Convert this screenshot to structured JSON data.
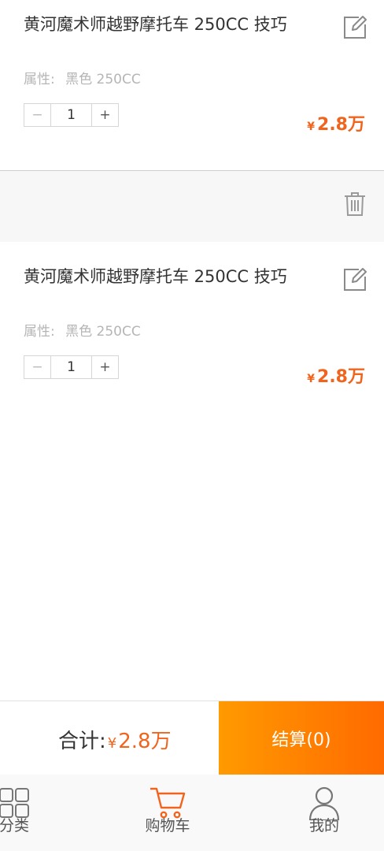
{
  "cart": {
    "items": [
      {
        "title": "黄河魔术师越野摩托车 250CC 技巧",
        "attr_label": "属性:",
        "attr_value": "黑色 250CC",
        "quantity": "1",
        "minus": "−",
        "plus": "+",
        "currency": "¥",
        "price": "2.8万"
      },
      {
        "title": "黄河魔术师越野摩托车 250CC 技巧",
        "attr_label": "属性:",
        "attr_value": "黑色 250CC",
        "quantity": "1",
        "minus": "−",
        "plus": "+",
        "currency": "¥",
        "price": "2.8万"
      }
    ]
  },
  "checkout": {
    "total_label": "合计:",
    "currency": "¥",
    "total_amount": "2.8万",
    "pay_label": "结算(0)"
  },
  "tabbar": {
    "tabs": [
      {
        "label": "分类",
        "icon": "grid-icon"
      },
      {
        "label": "购物车",
        "icon": "cart-icon",
        "active": true
      },
      {
        "label": "我的",
        "icon": "user-icon"
      }
    ]
  },
  "colors": {
    "accent": "#f0641e",
    "pay_gradient_start": "#ff9a00",
    "pay_gradient_end": "#ff6a00"
  }
}
